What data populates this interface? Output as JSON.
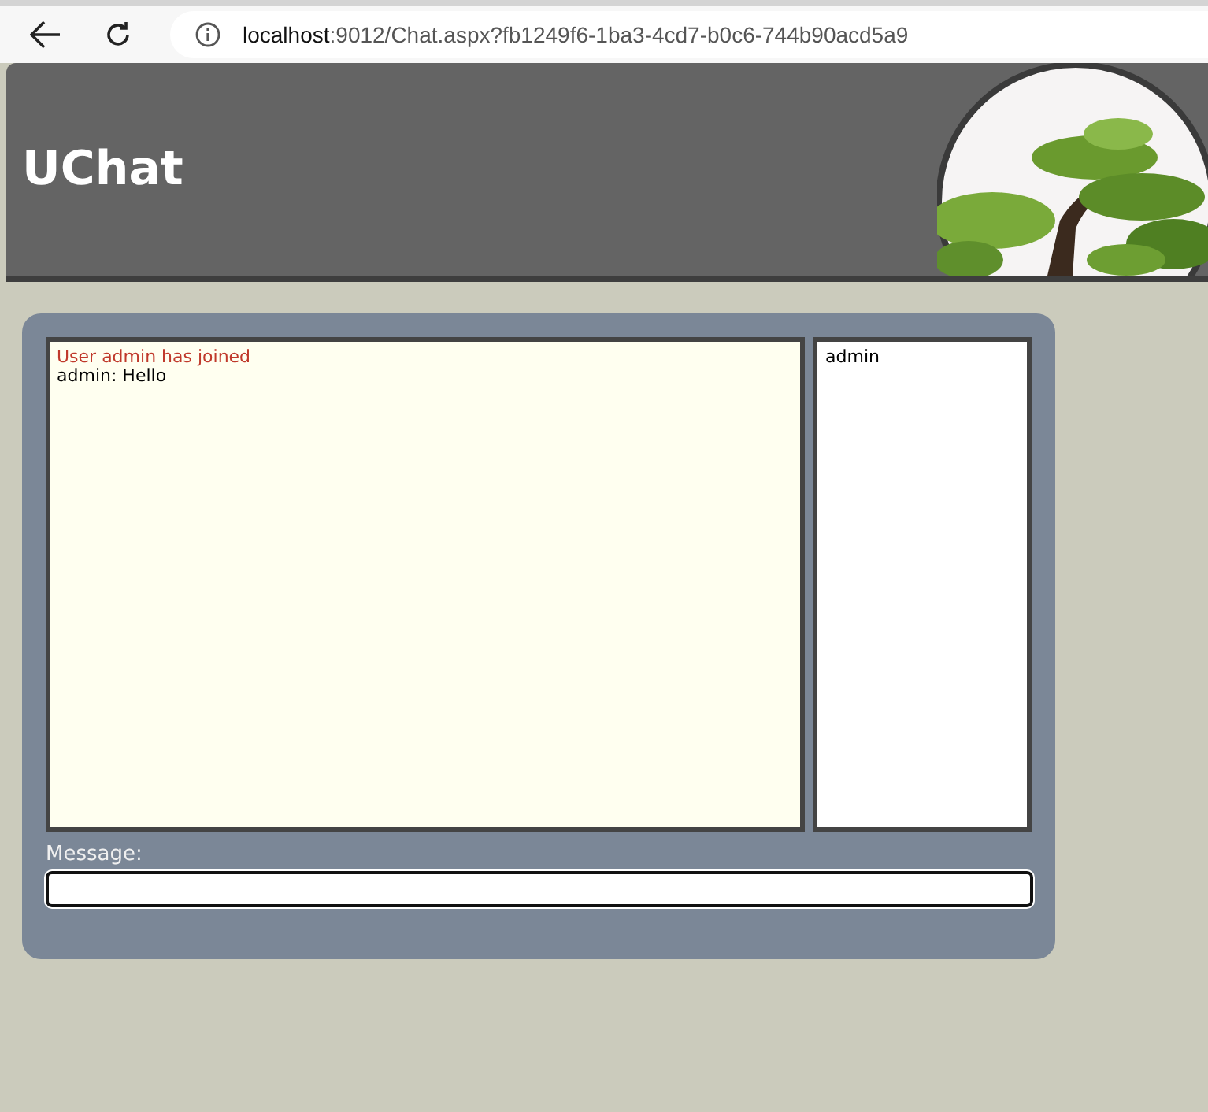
{
  "browser": {
    "url_host": "localhost",
    "url_path": ":9012/Chat.aspx?fb1249f6-1ba3-4cd7-b0c6-744b90acd5a9"
  },
  "header": {
    "title": "UChat"
  },
  "messages": [
    {
      "kind": "system",
      "text": "User admin has joined"
    },
    {
      "kind": "chat",
      "text": "admin: Hello"
    }
  ],
  "users": [
    "admin"
  ],
  "composer": {
    "label": "Message:"
  }
}
